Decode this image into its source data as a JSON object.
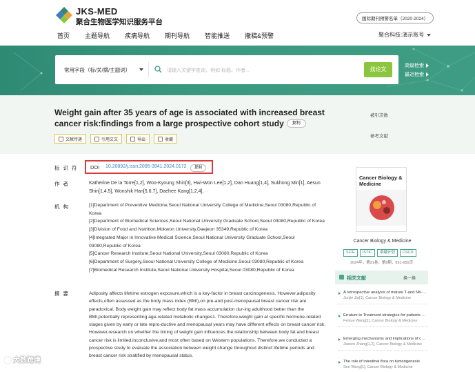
{
  "header": {
    "brand_en": "JKS-MED",
    "brand_cn": "聚合生物医学知识服务平台",
    "badge": "国际期刊预警名单（2020-2024）",
    "nav": [
      "首页",
      "主题导航",
      "疾病导航",
      "期刊导航",
      "智能推送",
      "撤稿&预警"
    ],
    "user": "聚合科技:演示账号"
  },
  "search": {
    "type": "常用字段（标/关/摘/主题词）",
    "placeholder": "请输入关键字查询，例如 标题、作者...",
    "button": "找论文",
    "advanced": "高级检索",
    "recent": "最近检索"
  },
  "article": {
    "title": "Weight gain after 35 years of age is associated with increased breast cancer risk:findings from a large prospective cohort study",
    "copy": "复制",
    "stat1": "被引次数",
    "stat2": "参考文献",
    "actions": [
      "文献传递",
      "引用文文",
      "导出",
      "收藏"
    ],
    "labels": {
      "id": "标识符",
      "authors": "作者",
      "affil": "机构",
      "abstract": "摘要"
    },
    "doi_key": "DOI",
    "doi": "10.20892/j.issn.2095-3941.2024.0172",
    "authors": "Katherine De la Torre[1,2], Woo-Kyoung Shin[3], Hwi-Won Lee[1,2], Dan Huang[1,4], Sukhong Min[1], Aesun Shin[1,4,5], Wonshik Han[5,6,7], Daehee Kang[1,2,4],",
    "affiliations": [
      "[1]Department of Preventive Medicine,Seoul National University College of Medicine,Seoul 03080,Republic of Korea",
      "[2]Department of Biomedical Sciences,Seoul National University Graduate School,Seoul 03080,Republic of Korea",
      "[3]Division of Food and Nutrition,Mokwon University,Daejeon 35349,Republic of Korea",
      "[4]Integrated Major in Innovative Medical Science,Seoul National University Graduate School,Seoul 03080,Republic of Korea",
      "[5]Cancer Research Institute,Seoul National University,Seoul 03080,Republic of Korea",
      "[6]Department of Surgery,Seoul National University College of Medicine,Seoul 03080,Republic of Korea",
      "[7]Biomedical Research Institute,Seoul National University Hospital,Seoul 03080,Republic of Korea"
    ],
    "abstract": "Adiposity affects lifetime estrogen exposure,which is a key-factor in breast carcinogenesis. However,adiposity effects,often assessed as the body mass index (BMI),on pre-and post-menopausal breast cancer risk are paradoxical. Body weight gain may reflect body fat mass accumulation dur-ing adulthood better than the BMI,potentially representing age-related metabolic changes1. Therefore,weight gain at specific hormone-related stages given by early or late repro-ductive and menopausal years may have different effects on breast cancer risk. However,research on whether the timing of weight gain influences the relationship between body fat and breast cancer risk is limited,inconclusive,and most often based on Western populations. Therefore,we conducted a prospective study to evaluate the association between weight change throughout distinct lifetime periods and breast cancer risk stratified by menopausal status."
  },
  "sidebar": {
    "cover_title": "Cancer Biology & Medicine",
    "journal": "Cancer Biology & Medicine",
    "tags": [
      "SCIE",
      "ISTIC",
      "卓越计划",
      "CSCD"
    ],
    "meta": "2024年，第21卷，第8期，651-655页",
    "related_title": "相关文献",
    "related_action": "换一换",
    "related": [
      {
        "title": "A retrospective analysis of mature T-and NK-cell lymphomas",
        "source": "Junjie Jia[1], Cancer Biology & Medicine"
      },
      {
        "title": "Erratum to Treatment strategies for patients with cancer",
        "source": "Feixue Wang[1], Cancer Biology & Medicine"
      },
      {
        "title": "Emerging mechanisms and implications of cancer",
        "source": "Jiawen Zhang[1,2], Cancer Biology & Medicine"
      },
      {
        "title": "The role of intestinal flora on tumorigenesis",
        "source": "Sen Wang[1], Cancer Biology & Medicine"
      }
    ]
  },
  "watermark": "大数跨境"
}
